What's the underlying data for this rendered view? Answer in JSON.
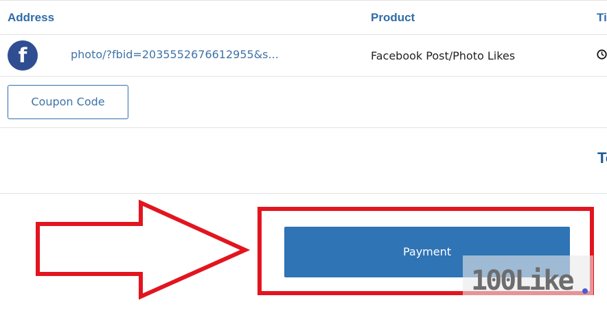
{
  "table": {
    "headers": {
      "address": "Address",
      "product": "Product",
      "time": "Ti"
    },
    "rows": [
      {
        "avatar_icon": "facebook-icon",
        "avatar_glyph": "f",
        "address": "photo/?fbid=2035552676612955&s...",
        "product": "Facebook Post/Photo Likes",
        "time_icon": "clock-icon"
      }
    ]
  },
  "coupon": {
    "label": "Coupon Code"
  },
  "total": {
    "label": "To"
  },
  "payment": {
    "label": "Payment"
  },
  "watermark": {
    "text": "100Like"
  },
  "colors": {
    "accent": "#2f6da8",
    "button": "#2f74b5",
    "facebook": "#2f4e92",
    "highlight": "#e2151f"
  }
}
